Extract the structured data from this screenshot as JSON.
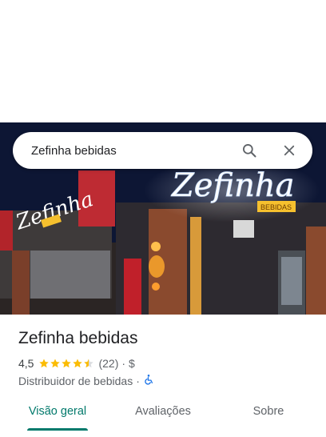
{
  "search": {
    "query": "Zefinha bebidas"
  },
  "icons": {
    "search": "search-icon",
    "close": "close-icon",
    "star": "star-icon",
    "accessibility": "wheelchair-icon"
  },
  "hero": {
    "sign_text": "Zefinha",
    "sign_sub": "BEBIDAS",
    "side_sign_text": "Zefinha"
  },
  "place": {
    "title": "Zefinha bebidas",
    "rating": "4,5",
    "stars_value": 4.5,
    "reviews": "(22)",
    "separator": "·",
    "price": "$",
    "category": "Distribuidor de bebidas",
    "category_separator": "·"
  },
  "tabs": [
    {
      "label": "Visão geral",
      "active": true
    },
    {
      "label": "Avaliações",
      "active": false
    },
    {
      "label": "Sobre",
      "active": false
    }
  ],
  "colors": {
    "accent": "#00796b",
    "star": "#fbbc04",
    "accessibility": "#1a73e8"
  }
}
